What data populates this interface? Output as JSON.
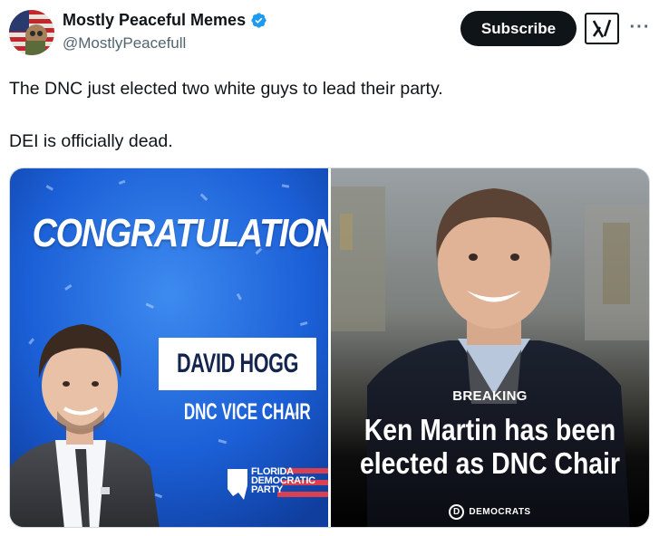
{
  "author": {
    "display_name": "Mostly Peaceful Memes",
    "handle": "@MostlyPeacefull",
    "verified": true,
    "avatar_icon": "avatar-image"
  },
  "actions": {
    "subscribe_label": "Subscribe",
    "grok_icon": "grok-icon",
    "more_icon": "more-options-icon",
    "more_glyph": "···"
  },
  "tweet": {
    "line1": "The DNC just elected two white guys to lead their party.",
    "line2": "DEI is officially dead."
  },
  "media": {
    "left": {
      "title": "CONGRATULATIONS",
      "name": "DAVID HOGG",
      "role": "DNC VICE CHAIR",
      "logo_line1": "FLORIDA",
      "logo_line2": "DEMOCRATIC",
      "logo_line3": "PARTY"
    },
    "right": {
      "label": "BREAKING",
      "headline_line1": "Ken Martin has been",
      "headline_line2": "elected as DNC Chair",
      "badge_letter": "D",
      "badge_text": "DEMOCRATS"
    }
  },
  "colors": {
    "text": "#0f1419",
    "muted": "#536471",
    "verified": "#1d9bf0",
    "left_bg": "#1b5fd6"
  }
}
